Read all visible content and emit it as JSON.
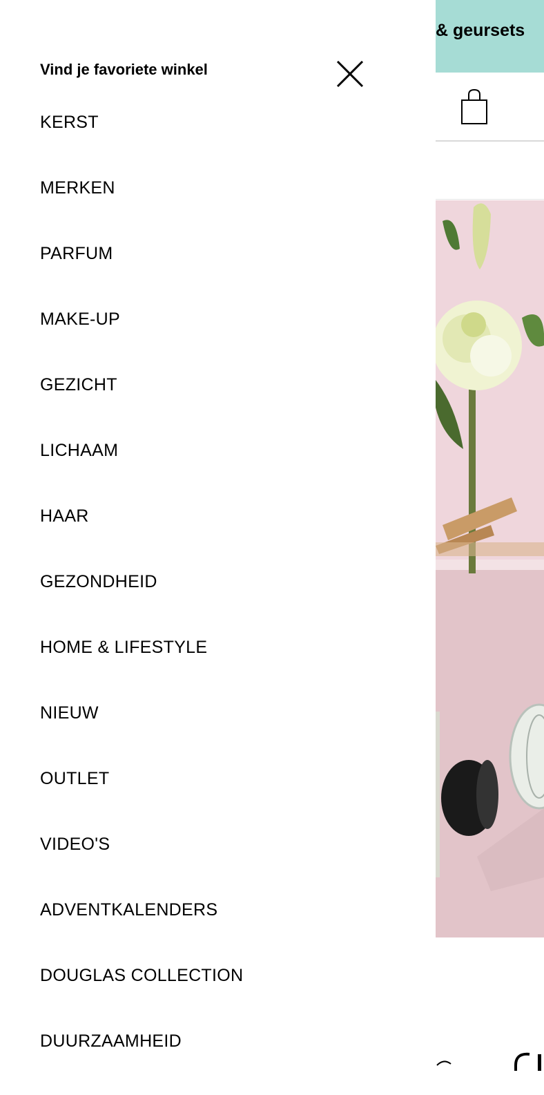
{
  "promo": {
    "text": "& geursets"
  },
  "header": {
    "bag_icon": "shopping-bag-icon"
  },
  "drawer": {
    "store_link": "Vind je favoriete winkel",
    "close_icon": "close-icon",
    "items": [
      {
        "label": "KERST"
      },
      {
        "label": "MERKEN"
      },
      {
        "label": "PARFUM"
      },
      {
        "label": "MAKE-UP"
      },
      {
        "label": "GEZICHT"
      },
      {
        "label": "LICHAAM"
      },
      {
        "label": "HAAR"
      },
      {
        "label": "GEZONDHEID"
      },
      {
        "label": "HOME & LIFESTYLE"
      },
      {
        "label": "NIEUW"
      },
      {
        "label": "OUTLET"
      },
      {
        "label": "VIDEO'S"
      },
      {
        "label": "ADVENTKALENDERS"
      },
      {
        "label": "DOUGLAS COLLECTION"
      },
      {
        "label": "DUURZAAMHEID"
      }
    ]
  },
  "colors": {
    "promo_bg": "#a6dcd5",
    "hero_bg": "#e9c9cf"
  }
}
